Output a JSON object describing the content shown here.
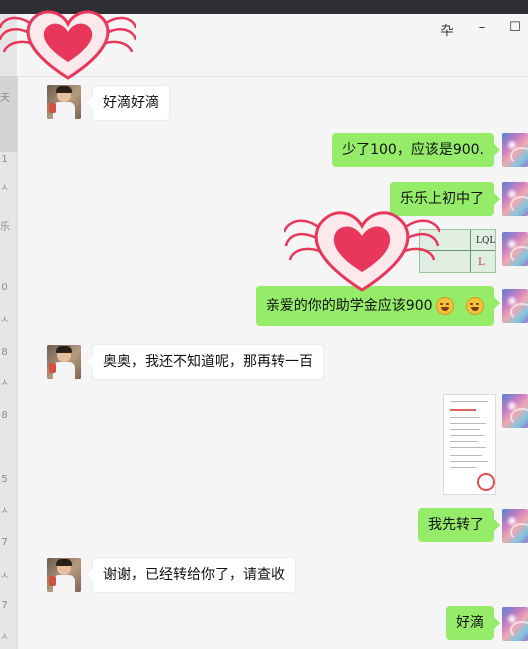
{
  "window": {
    "controls": {
      "pin": "卆",
      "minimize": "–",
      "maximize": "☐"
    }
  },
  "side_strip": {
    "chars": [
      "天",
      "1",
      "ㅅ",
      "乐",
      "0",
      "ㅅ",
      "8",
      "ㅅ",
      "8",
      "5",
      "ㅅ",
      "7",
      "ㅅ",
      "7",
      "ㅅ"
    ]
  },
  "messages": [
    {
      "side": "left",
      "text": "好滴好滴"
    },
    {
      "side": "right",
      "text": "少了100，应该是900."
    },
    {
      "side": "right",
      "text": "乐乐上初中了"
    },
    {
      "side": "right",
      "type": "image",
      "image_text": [
        "LQL",
        "L"
      ]
    },
    {
      "side": "right",
      "text": "亲爱的你的助学金应该900",
      "emoji": [
        "rofl-emoji",
        "rofl-emoji"
      ]
    },
    {
      "side": "left",
      "text": "奥奥，我还不知道呢，那再转一百"
    },
    {
      "side": "right",
      "type": "image",
      "image_text": []
    },
    {
      "side": "right",
      "text": "我先转了"
    },
    {
      "side": "left",
      "text": "谢谢，已经转给你了，请查收"
    },
    {
      "side": "right",
      "text": "好滴"
    }
  ],
  "colors": {
    "right_bubble": "#95ec69",
    "left_bubble": "#ffffff",
    "title_bar": "#2e2e33",
    "heart": "#e8375a"
  },
  "icons": [
    "heart-wings-icon",
    "heart-wings-icon",
    "rofl-emoji"
  ]
}
